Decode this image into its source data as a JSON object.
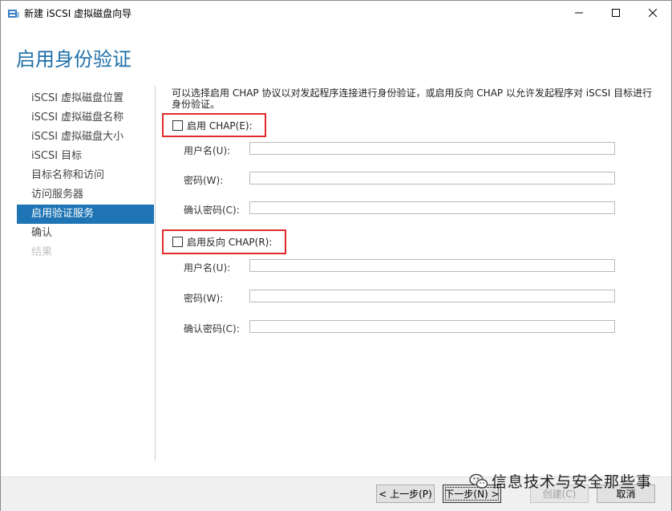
{
  "window": {
    "title": "新建 iSCSI 虚拟磁盘向导",
    "controls": {
      "minimize": "—",
      "maximize": "☐",
      "close": "✕"
    }
  },
  "page": {
    "title": "启用身份验证"
  },
  "nav": {
    "items": [
      {
        "label": "iSCSI 虚拟磁盘位置",
        "state": "normal"
      },
      {
        "label": "iSCSI 虚拟磁盘名称",
        "state": "normal"
      },
      {
        "label": "iSCSI 虚拟磁盘大小",
        "state": "normal"
      },
      {
        "label": "iSCSI 目标",
        "state": "normal"
      },
      {
        "label": "目标名称和访问",
        "state": "normal"
      },
      {
        "label": "访问服务器",
        "state": "normal"
      },
      {
        "label": "启用验证服务",
        "state": "active"
      },
      {
        "label": "确认",
        "state": "normal"
      },
      {
        "label": "结果",
        "state": "disabled"
      }
    ]
  },
  "content": {
    "description": "可以选择启用 CHAP 协议以对发起程序连接进行身份验证，或启用反向 CHAP 以允许发起程序对 iSCSI 目标进行身份验证。",
    "chap": {
      "checkbox_label": "启用 CHAP(E):",
      "checked": false,
      "username_label": "用户名(U):",
      "password_label": "密码(W):",
      "confirm_label": "确认密码(C):",
      "username_value": "",
      "password_value": "",
      "confirm_value": ""
    },
    "reverse_chap": {
      "checkbox_label": "启用反向 CHAP(R):",
      "checked": false,
      "username_label": "用户名(U):",
      "password_label": "密码(W):",
      "confirm_label": "确认密码(C):",
      "username_value": "",
      "password_value": "",
      "confirm_value": ""
    }
  },
  "footer": {
    "prev_label": "< 上一步(P)",
    "next_label": "下一步(N) >",
    "create_label": "创建(C)",
    "cancel_label": "取消"
  },
  "watermark": {
    "text": "信息技术与安全那些事"
  },
  "colors": {
    "accent": "#1e74b4",
    "title": "#1e6fa8",
    "highlight_box": "#e12b2b"
  }
}
